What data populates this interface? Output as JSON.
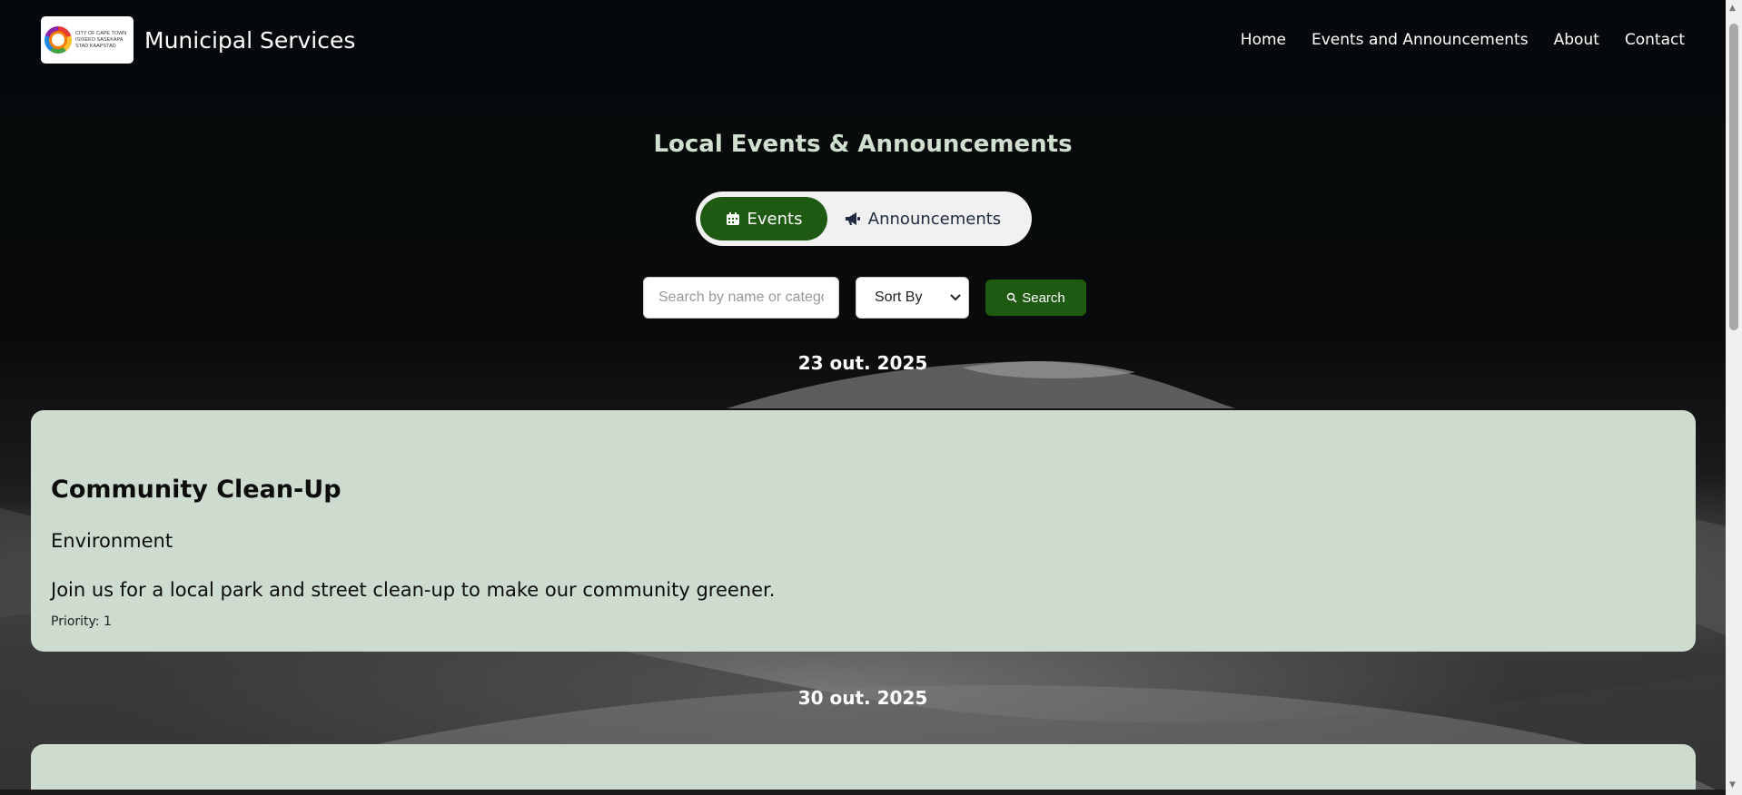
{
  "header": {
    "logo_text": [
      "CITY OF CAPE TOWN",
      "ISIXEKO SASEKAPA",
      "STAD KAAPSTAD"
    ],
    "brand": "Municipal Services",
    "nav": [
      "Home",
      "Events and Announcements",
      "About",
      "Contact"
    ]
  },
  "main": {
    "title": "Local Events & Announcements",
    "tabs": {
      "events": "Events",
      "announcements": "Announcements"
    },
    "search": {
      "placeholder": "Search by name or category",
      "value": ""
    },
    "sort": {
      "selected": "Sort By"
    },
    "search_button": "Search"
  },
  "events": [
    {
      "date": "23 out. 2025",
      "title": "Community Clean-Up",
      "category": "Environment",
      "description": "Join us for a local park and street clean-up to make our community greener.",
      "priority": "Priority: 1"
    },
    {
      "date": "30 out. 2025"
    }
  ],
  "colors": {
    "accent": "#1f5a12",
    "card_bg": "#cddccf",
    "title": "#cfe0cf"
  },
  "icons": {
    "events_tab": "calendar-icon",
    "announcements_tab": "megaphone-icon",
    "search_button": "magnifier-icon",
    "sort": "chevron-down-icon"
  }
}
